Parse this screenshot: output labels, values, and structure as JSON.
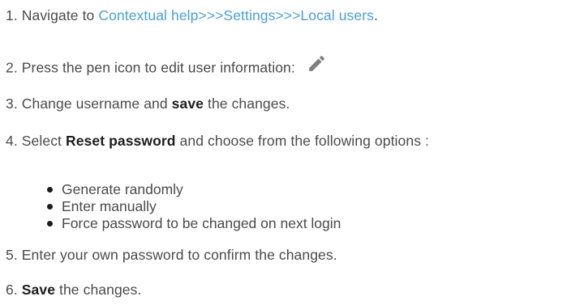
{
  "steps": [
    {
      "number": "1.",
      "prefix": "Navigate to ",
      "link": "Contextual help>>>Settings>>>Local users",
      "suffix": "."
    },
    {
      "number": "2.",
      "text": "Press the pen icon to edit user information:",
      "icon": "pencil-icon"
    },
    {
      "number": "3.",
      "before": "Change username and ",
      "bold": "save",
      "after": " the changes."
    },
    {
      "number": "4.",
      "before": "Select ",
      "bold": "Reset password",
      "after": " and choose from the following options :"
    },
    {
      "number": "5.",
      "text": "Enter your own password to confirm the changes."
    },
    {
      "number": "6.",
      "bold": "Save",
      "after": " the changes."
    }
  ],
  "options": [
    "Generate randomly",
    "Enter manually",
    "Force password to be changed on next login"
  ],
  "colors": {
    "text": "#4a4a4a",
    "link": "#4a9fd6",
    "bold": "#1c1c1c",
    "icon": "#808080"
  }
}
